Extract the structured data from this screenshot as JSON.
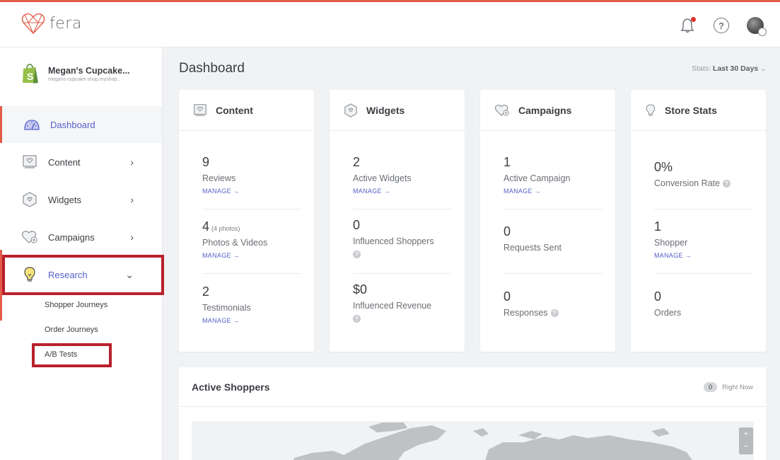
{
  "app": {
    "logo_text": "fera",
    "brand_color": "#e25c48",
    "accent_color": "#5560c8"
  },
  "header": {
    "icons": [
      "bell-icon",
      "help-icon",
      "avatar"
    ],
    "help_glyph": "?"
  },
  "store": {
    "name": "Megan's Cupcake...",
    "url": "megans-cupcake-shop.myshop..."
  },
  "sidebar": {
    "items": [
      {
        "label": "Dashboard",
        "icon": "dashboard-gauge-icon",
        "active": true
      },
      {
        "label": "Content",
        "icon": "content-icon",
        "chevron": "›"
      },
      {
        "label": "Widgets",
        "icon": "widgets-icon",
        "chevron": "›"
      },
      {
        "label": "Campaigns",
        "icon": "campaigns-icon",
        "chevron": "›"
      },
      {
        "label": "Research",
        "icon": "lightbulb-icon",
        "chevron": "⌄",
        "expanded": true
      }
    ],
    "research_sub": [
      "Shopper Journeys",
      "Order Journeys",
      "A/B Tests"
    ]
  },
  "main": {
    "title": "Dashboard",
    "stats_label": "Stats:",
    "stats_range": "Last 30 Days",
    "stats_chevron": "⌄"
  },
  "cards": {
    "content": {
      "title": "Content",
      "stats": [
        {
          "value": "9",
          "label": "Reviews",
          "link": "MANAGE →"
        },
        {
          "value": "4",
          "note": "(4 photos)",
          "label": "Photos & Videos",
          "link": "MANAGE →"
        },
        {
          "value": "2",
          "label": "Testimonials",
          "link": "MANAGE →"
        }
      ]
    },
    "widgets": {
      "title": "Widgets",
      "stats": [
        {
          "value": "2",
          "label": "Active Widgets",
          "link": "MANAGE →"
        },
        {
          "value": "0",
          "label": "Influenced Shoppers"
        },
        {
          "value": "$0",
          "label": "Influenced Revenue"
        }
      ]
    },
    "campaigns": {
      "title": "Campaigns",
      "stats": [
        {
          "value": "1",
          "label": "Active Campaign",
          "link": "MANAGE →"
        },
        {
          "value": "0",
          "label": "Requests Sent"
        },
        {
          "value": "0",
          "label": "Responses"
        }
      ]
    },
    "store_stats": {
      "title": "Store Stats",
      "stats": [
        {
          "value": "0%",
          "label": "Conversion Rate"
        },
        {
          "value": "1",
          "label": "Shopper",
          "link": "MANAGE →"
        },
        {
          "value": "0",
          "label": "Orders"
        }
      ]
    }
  },
  "active_shoppers": {
    "title": "Active Shoppers",
    "count": "0",
    "count_label": "Right Now",
    "zoom_in": "+",
    "zoom_out": "−"
  }
}
